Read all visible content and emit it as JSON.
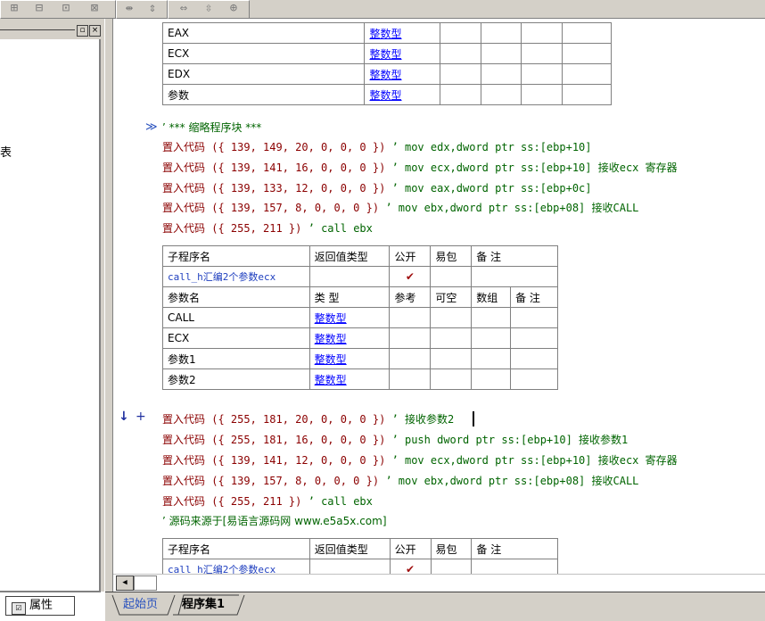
{
  "toolbar": {
    "icons": [
      "cols-icon",
      "rows-icon",
      "merge-icon",
      "split-icon",
      "width-icon",
      "height-icon",
      "fit-width-icon",
      "fit-height-icon",
      "fit-all-icon"
    ]
  },
  "left_panel": {
    "partial_text": "表",
    "tab_label": "属性"
  },
  "reg_table": {
    "rows": [
      {
        "name": "EAX",
        "type": "整数型"
      },
      {
        "name": "ECX",
        "type": "整数型"
      },
      {
        "name": "EDX",
        "type": "整数型"
      },
      {
        "name": "参数",
        "type": "整数型"
      }
    ]
  },
  "block_comment": "’ *** 缩略程序块 ***",
  "code1": [
    {
      "cmd": "置入代码",
      "args": " ({ 139, 149, 20, 0, 0, 0 })",
      "cmt": " ’ mov edx,dword ptr ss:[ebp+10]"
    },
    {
      "cmd": "置入代码",
      "args": " ({ 139, 141, 16, 0, 0, 0 })",
      "cmt": " ’ mov ecx,dword ptr ss:[ebp+10] 接收ecx 寄存器"
    },
    {
      "cmd": "置入代码",
      "args": " ({ 139, 133, 12, 0, 0, 0 })",
      "cmt": " ’ mov eax,dword ptr ss:[ebp+0c]"
    },
    {
      "cmd": "置入代码",
      "args": " ({ 139, 157, 8, 0, 0, 0 })",
      "cmt": " ’ mov ebx,dword ptr ss:[ebp+08] 接收CALL"
    },
    {
      "cmd": "置入代码",
      "args": " ({ 255, 211 })",
      "cmt": " ’ call ebx"
    }
  ],
  "sub_table_headers": [
    "子程序名",
    "返回值类型",
    "公开",
    "易包",
    "备 注"
  ],
  "sub_name": "call_h汇编2个参数ecx",
  "public_mark": "✔",
  "param_headers": [
    "参数名",
    "类 型",
    "参考",
    "可空",
    "数组",
    "备 注"
  ],
  "params": [
    {
      "name": "CALL",
      "type": "整数型"
    },
    {
      "name": "ECX",
      "type": "整数型"
    },
    {
      "name": "参数1",
      "type": "整数型"
    },
    {
      "name": "参数2",
      "type": "整数型"
    }
  ],
  "gutter_marks": {
    "arrow": "↓",
    "plus": "+",
    "block": "≫"
  },
  "code2": [
    {
      "cmd": "置入代码",
      "args": " ({ 255, 181, 20, 0, 0, 0 })",
      "cmt": " ’ 接收参数2"
    },
    {
      "cmd": "置入代码",
      "args": " ({ 255, 181, 16, 0, 0, 0 })",
      "cmt": " ’ push dword ptr ss:[ebp+10] 接收参数1"
    },
    {
      "cmd": "置入代码",
      "args": " ({ 139, 141, 12, 0, 0, 0 })",
      "cmt": " ’ mov ecx,dword ptr ss:[ebp+10] 接收ecx 寄存器"
    },
    {
      "cmd": "置入代码",
      "args": " ({ 139, 157, 8, 0, 0, 0 })",
      "cmt": " ’ mov ebx,dword ptr ss:[ebp+08] 接收CALL"
    },
    {
      "cmd": "置入代码",
      "args": " ({ 255, 211 })",
      "cmt": " ’ call ebx"
    }
  ],
  "source_comment": "’ 源码来源于[易语言源码网 www.e5a5x.com]",
  "second_sub_name_partial": "call_h汇编2个参数ecx",
  "tabs": {
    "start": "起始页",
    "program": "程序集1"
  }
}
